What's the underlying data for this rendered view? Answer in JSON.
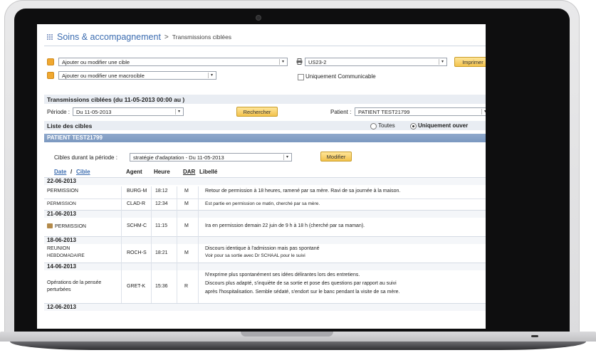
{
  "breadcrumb": {
    "title": "Soins & accompagnement",
    "sep": ">",
    "sub": "Transmissions ciblées"
  },
  "toolbar": {
    "cible_select": "Ajouter ou modifier une cible",
    "macrocible_select": "Ajouter ou modifier une macrocible",
    "unit_select": "US23-2",
    "print_label": "Imprimer",
    "communicable_label": "Uniquement Communicable"
  },
  "filter": {
    "section_title": "Transmissions ciblées (du 11-05-2013 00:00 au )",
    "periode_label": "Période :",
    "periode_value": "Du 11-05-2013",
    "search_label": "Rechercher",
    "patient_label": "Patient :",
    "patient_value": "PATIENT TEST21799"
  },
  "list": {
    "title": "Liste des cibles",
    "radio_all": "Toutes",
    "radio_open": "Uniquement ouver",
    "patient_name": "PATIENT TEST21799",
    "cibles_label": "Cibles durant la période :",
    "cibles_value": "stratégie d'adaptation - Du 11-05-2013",
    "modify_label": "Modifier"
  },
  "table": {
    "headers": {
      "date": "Date",
      "slash": "/",
      "cible": "Cible",
      "agent": "Agent",
      "heure": "Heure",
      "dar": "DAR",
      "libelle": "Libellé"
    },
    "groups": [
      {
        "date": "22-06-2013",
        "rows": [
          {
            "cible": "PERMISSION",
            "agent": "BURG-M",
            "heure": "18:12",
            "dar": "M",
            "libelle": "Retour de permission à 18 heures, ramené par sa mère. Ravi de sa journée à la maison."
          },
          {
            "cible": "PERMISSION",
            "agent": "CLAD-R",
            "heure": "12:34",
            "dar": "M",
            "libelle": "Est partie en permission ce matin, cherché par sa mère."
          }
        ]
      },
      {
        "date": "21-06-2013",
        "rows": [
          {
            "cible": "PERMISSION",
            "agent": "SCHM-C",
            "heure": "11:15",
            "dar": "M",
            "libelle": "Ira en permission demain 22 juin de 9 h à 18 h (cherché par sa maman)."
          }
        ]
      },
      {
        "date": "18-06-2013",
        "rows": [
          {
            "cible": "REUNION",
            "cible2": "HEBDOMADAIRE",
            "agent": "ROCH-S",
            "heure": "18:21",
            "dar": "M",
            "libelle": "Discours identique à l'admission mais pas spontané",
            "libelle2": "Voir pour sa sortie avec Dr SCHAAL pour le suivi"
          }
        ]
      },
      {
        "date": "14-06-2013",
        "rows": [
          {
            "cible": "Opérations de la pensée",
            "cible2": "perturbées",
            "agent": "GRET-K",
            "heure": "15:36",
            "dar": "R",
            "libelle": "N'exprime plus spontanément ses idées délirantes lors des entretiens.",
            "libelle2": "Discours plus adapté, s'inquiète de sa sortie et pose des questions par rapport au suivi",
            "libelle3": "après l'hospitalisation. Semble sédaté, s'endort sur le banc pendant la visite de sa mère."
          }
        ]
      },
      {
        "date": "12-06-2013",
        "rows": []
      }
    ]
  }
}
